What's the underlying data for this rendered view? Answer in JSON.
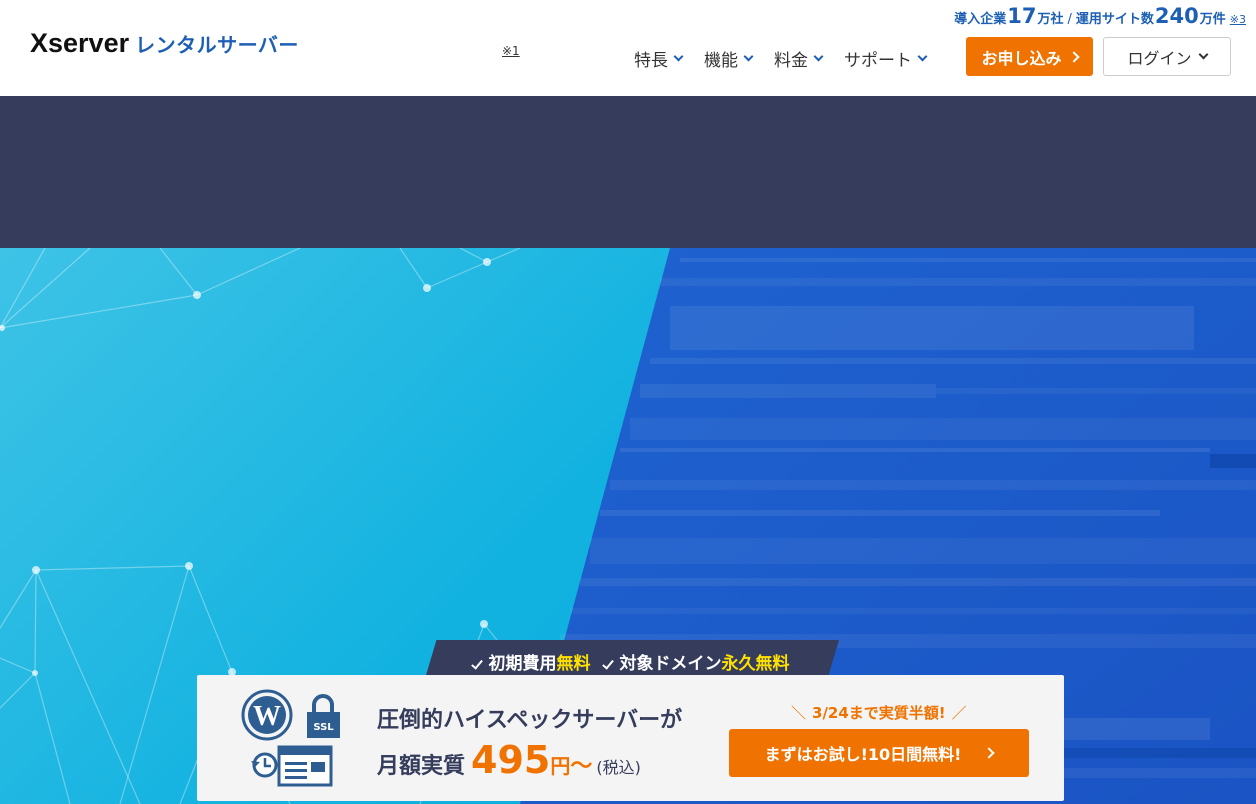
{
  "header": {
    "logo_main": "Xserver",
    "logo_sub": "レンタルサーバー",
    "note1": "※1",
    "stats": {
      "label1": "導入企業",
      "value1": "17",
      "unit1": "万社",
      "separator": "/",
      "label2": "運用サイト数",
      "value2": "240",
      "unit2": "万件",
      "note3": "※3"
    },
    "nav": [
      {
        "label": "特長"
      },
      {
        "label": "機能"
      },
      {
        "label": "料金"
      },
      {
        "label": "サポート"
      }
    ],
    "apply_label": "お申し込み",
    "login_label": "ログイン"
  },
  "colors": {
    "accent": "#f07200",
    "brand": "#1d5fb4",
    "dark_band": "#353c5c",
    "highlight": "#ffe100",
    "hero_cyan": "#12b2e0",
    "hero_blue": "#1e63d0"
  },
  "badge": {
    "item1_prefix": "初期費用",
    "item1_highlight": "無料",
    "item2_prefix": "対象ドメイン",
    "item2_highlight": "永久無料"
  },
  "promo": {
    "icons": [
      "wordpress-icon",
      "ssl-lock-icon",
      "backup-restore-icon"
    ],
    "ssl_label": "SSL",
    "line1": "圧倒的ハイスペックサーバーが",
    "line2_prefix": "月額実質",
    "price": "495",
    "unit": "円",
    "tilde": "〜",
    "tax": "(税込)",
    "campaign": "3/24まで実質半額!",
    "campaign_left": "＼",
    "campaign_right": "／",
    "trial_label": "まずはお試し!10日間無料!"
  }
}
